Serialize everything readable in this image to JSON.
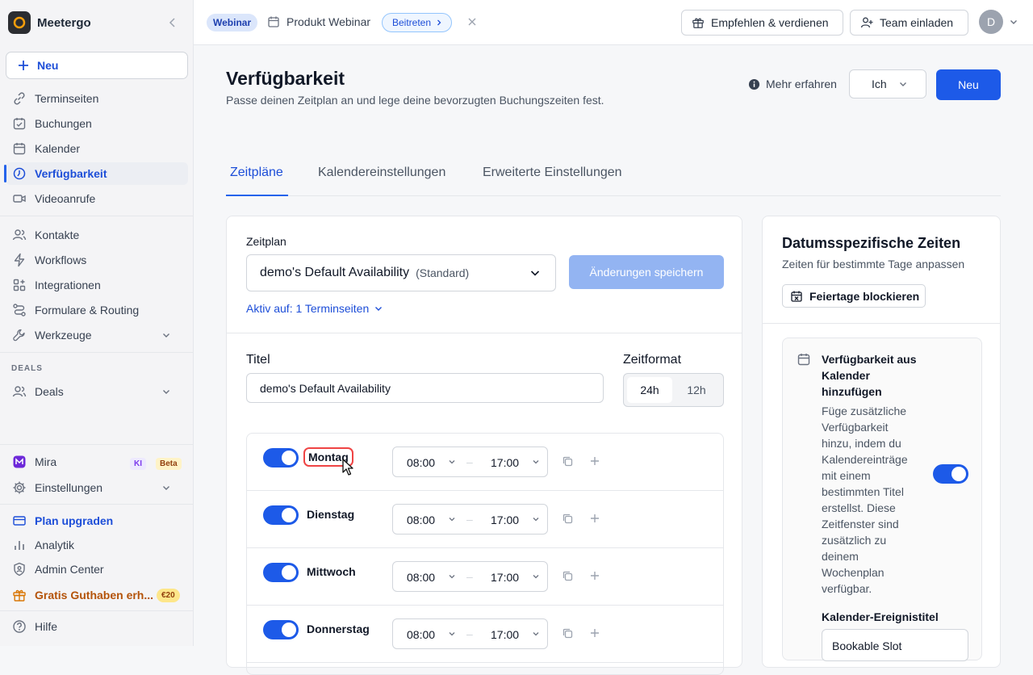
{
  "sidebar": {
    "brand": "Meetergo",
    "new_label": "Neu",
    "items": [
      {
        "label": "Terminseiten",
        "icon": "link-icon"
      },
      {
        "label": "Buchungen",
        "icon": "calendar-check-icon"
      },
      {
        "label": "Kalender",
        "icon": "calendar-icon"
      },
      {
        "label": "Verfügbarkeit",
        "icon": "clock-icon"
      },
      {
        "label": "Videoanrufe",
        "icon": "video-icon"
      },
      {
        "label": "Kontakte",
        "icon": "users-icon"
      },
      {
        "label": "Workflows",
        "icon": "lightning-icon"
      },
      {
        "label": "Integrationen",
        "icon": "grid-plus-icon"
      },
      {
        "label": "Formulare & Routing",
        "icon": "routing-icon"
      },
      {
        "label": "Werkzeuge",
        "icon": "wrench-icon"
      }
    ],
    "deals_section": "DEALS",
    "deals_label": "Deals",
    "mira_label": "Mira",
    "mira_badge_ki": "KI",
    "mira_badge_beta": "Beta",
    "settings_label": "Einstellungen",
    "upgrade_label": "Plan upgraden",
    "analytics_label": "Analytik",
    "admin_label": "Admin Center",
    "credit_label": "Gratis Guthaben erh...",
    "credit_badge": "€20",
    "help_label": "Hilfe"
  },
  "topbar": {
    "webinar_badge": "Webinar",
    "webinar_title": "Produkt Webinar",
    "join_label": "Beitreten",
    "recommend_label": "Empfehlen & verdienen",
    "invite_label": "Team einladen",
    "avatar_letter": "D"
  },
  "header": {
    "title": "Verfügbarkeit",
    "subtitle": "Passe deinen Zeitplan an und lege deine bevorzugten Buchungszeiten fest.",
    "learn_more": "Mehr erfahren",
    "owner_select": "Ich",
    "new_button": "Neu"
  },
  "tabs": [
    {
      "label": "Zeitpläne",
      "active": true
    },
    {
      "label": "Kalendereinstellungen",
      "active": false
    },
    {
      "label": "Erweiterte Einstellungen",
      "active": false
    }
  ],
  "schedule": {
    "label": "Zeitplan",
    "selected": "demo's Default Availability",
    "selected_tag": "(Standard)",
    "save_button": "Änderungen speichern",
    "active_on": "Aktiv auf: 1 Terminseiten",
    "title_label": "Titel",
    "title_value": "demo's Default Availability",
    "format_label": "Zeitformat",
    "format_options": [
      "24h",
      "12h"
    ],
    "format_selected": "24h",
    "days": [
      {
        "name": "Montag",
        "enabled": true,
        "start": "08:00",
        "end": "17:00"
      },
      {
        "name": "Dienstag",
        "enabled": true,
        "start": "08:00",
        "end": "17:00"
      },
      {
        "name": "Mittwoch",
        "enabled": true,
        "start": "08:00",
        "end": "17:00"
      },
      {
        "name": "Donnerstag",
        "enabled": true,
        "start": "08:00",
        "end": "17:00"
      }
    ]
  },
  "date_specific": {
    "title": "Datumsspezifische Zeiten",
    "subtitle": "Zeiten für bestimmte Tage anpassen",
    "holiday_button": "Feiertage blockieren",
    "calendar_title": "Verfügbarkeit aus Kalender hinzufügen",
    "calendar_desc": "Füge zusätzliche Verfügbarkeit hinzu, indem du Kalendereinträge mit einem bestimmten Titel erstellst. Diese Zeitfenster sind zusätzlich zu deinem Wochenplan verfügbar.",
    "calendar_enabled": true,
    "event_title_label": "Kalender-Ereignistitel",
    "event_title_value": "Bookable Slot"
  },
  "colors": {
    "accent": "#1d5ae8",
    "active_nav": "#1d4ed8",
    "highlight": "#ef4444"
  }
}
